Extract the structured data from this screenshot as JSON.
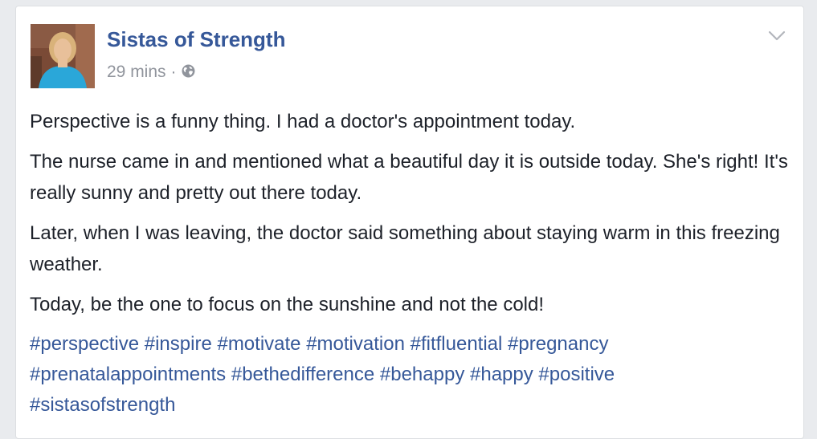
{
  "post": {
    "page_name": "Sistas of Strength",
    "time": "29 mins",
    "separator": "·",
    "audience_icon": "globe-icon",
    "menu_icon": "chevron-down-icon",
    "paragraphs": [
      "Perspective is a funny thing. I had a doctor's appointment today.",
      "The nurse came in and mentioned what a beautiful day it is outside today. She's right! It's really sunny and pretty out there today.",
      "Later, when I was leaving, the doctor said something about staying warm in this freezing weather.",
      "Today, be the one to focus on the sunshine and not the cold!"
    ],
    "hashtags": [
      "#perspective",
      "#inspire",
      "#motivate",
      "#motivation",
      "#fitfluential",
      "#pregnancy",
      "#prenatalappointments",
      "#bethedifference",
      "#behappy",
      "#happy",
      "#positive",
      "#sistasofstrength"
    ]
  },
  "colors": {
    "link": "#365899",
    "text": "#1d2129",
    "meta": "#90949c",
    "background": "#e9ebee",
    "card": "#ffffff"
  }
}
